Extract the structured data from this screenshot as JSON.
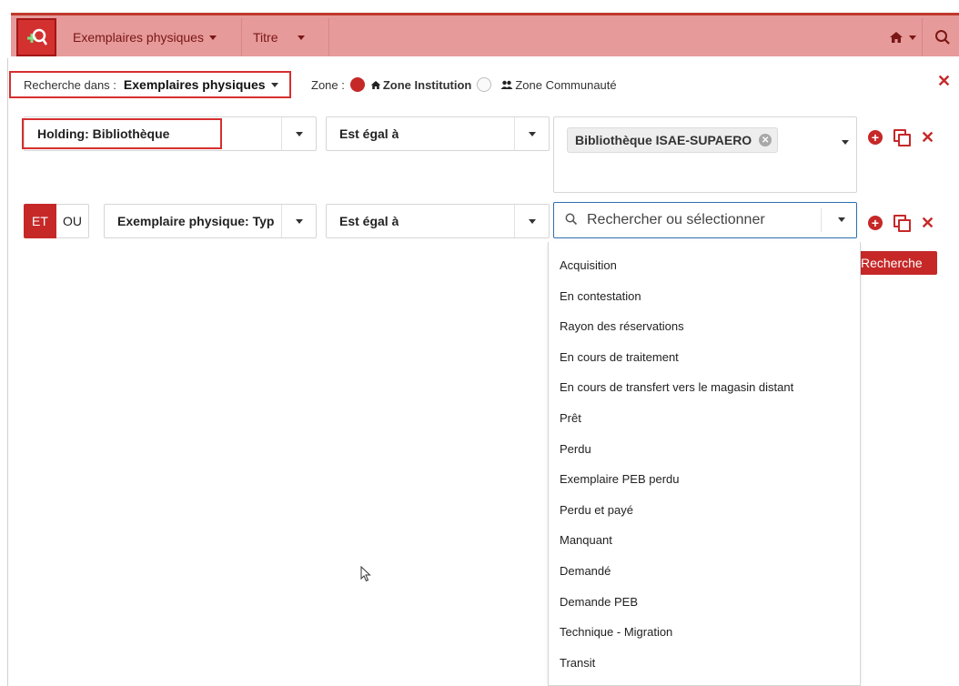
{
  "topbar": {
    "search_type_label": "Exemplaires physiques",
    "field_label": "Titre"
  },
  "scope": {
    "label": "Recherche dans :",
    "value": "Exemplaires physiques"
  },
  "zone": {
    "label": "Zone :",
    "institution": "Zone Institution",
    "community": "Zone Communauté"
  },
  "row1": {
    "field": "Holding: Bibliothèque",
    "operator": "Est égal à",
    "value_tag": "Bibliothèque ISAE-SUPAERO"
  },
  "row2": {
    "and_label": "ET",
    "or_label": "OU",
    "field": "Exemplaire physique: Typ",
    "operator": "Est égal à",
    "search_placeholder": "Rechercher ou sélectionner"
  },
  "search_button": "Recherche",
  "dropdown_options": [
    "Acquisition",
    "En contestation",
    "Rayon des réservations",
    "En cours de traitement",
    "En cours de transfert vers le magasin distant",
    "Prêt",
    "Perdu",
    "Exemplaire PEB perdu",
    "Perdu et payé",
    "Manquant",
    "Demandé",
    "Demande PEB",
    "Technique - Migration",
    "Transit"
  ],
  "colors": {
    "primary_red": "#c62828",
    "topbar_bg": "#e69a9a",
    "focus_blue": "#2f6fad"
  }
}
